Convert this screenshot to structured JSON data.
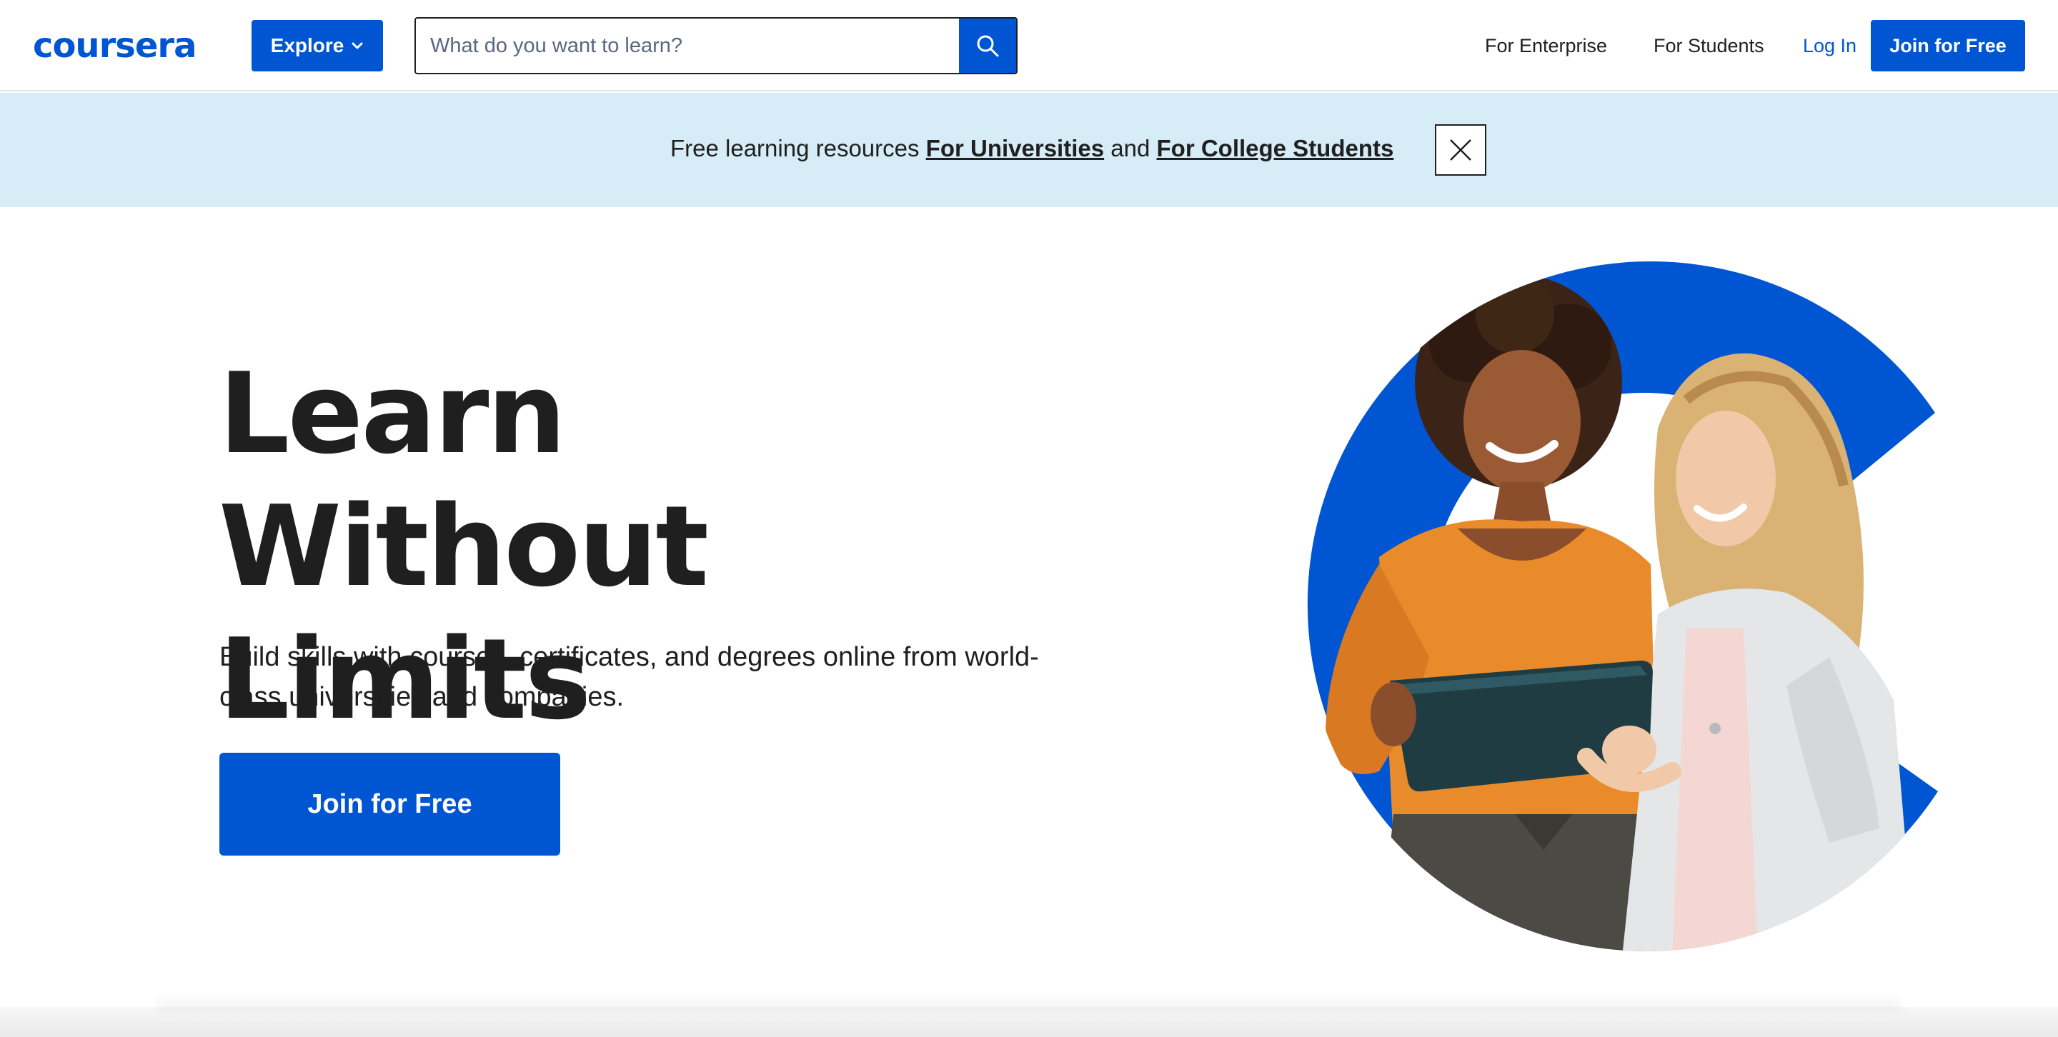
{
  "brand": {
    "name": "coursera",
    "color": "#0056d2"
  },
  "header": {
    "explore_label": "Explore",
    "search_placeholder": "What do you want to learn?",
    "search_value": "",
    "nav": {
      "enterprise": "For Enterprise",
      "students": "For Students",
      "login": "Log In"
    },
    "join_label": "Join for Free"
  },
  "banner": {
    "prefix": "Free learning resources ",
    "link_universities": "For Universities",
    "middle": " and ",
    "link_students": "For College Students"
  },
  "hero": {
    "title_line1": "Learn Without",
    "title_line2": "Limits",
    "subtitle": "Build skills with courses, certificates, and degrees online from world-class universities and companies.",
    "cta_label": "Join for Free"
  },
  "icons": {
    "search": "search-icon",
    "chevron": "chevron-down-icon",
    "close": "close-icon"
  }
}
